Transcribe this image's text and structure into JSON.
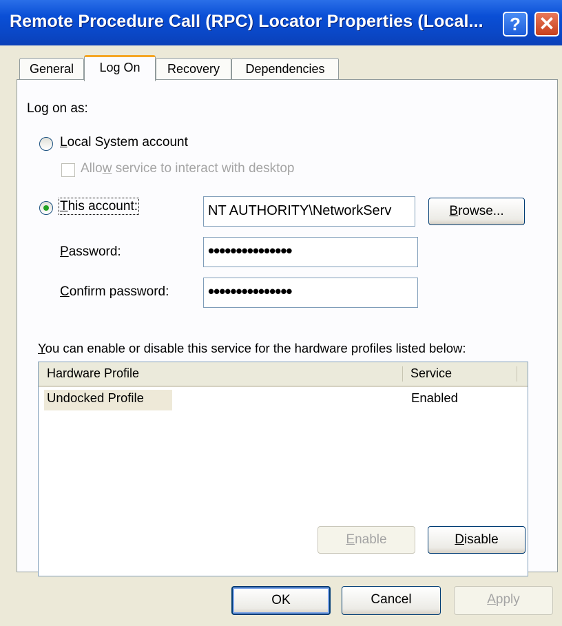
{
  "window": {
    "title": "Remote Procedure Call (RPC) Locator Properties (Local...",
    "help_glyph": "?",
    "close_glyph": "✕"
  },
  "tabs": [
    {
      "label": "General"
    },
    {
      "label": "Log On",
      "active": true
    },
    {
      "label": "Recovery"
    },
    {
      "label": "Dependencies"
    }
  ],
  "logon": {
    "heading": "Log on as:",
    "local_system": {
      "label_key": "L",
      "label_rest": "ocal System account",
      "selected": false
    },
    "interact": {
      "label_pre": "Allo",
      "label_key": "w",
      "label_rest": " service to interact with desktop",
      "checked": false,
      "disabled": true
    },
    "this_account": {
      "label_key": "T",
      "label_rest": "his account:",
      "selected": true,
      "value": "NT AUTHORITY\\NetworkServ"
    },
    "browse": {
      "label_key": "B",
      "label_rest": "rowse..."
    },
    "password": {
      "label_key": "P",
      "label_rest": "assword:",
      "value": "•••••••••••••••"
    },
    "confirm": {
      "label_key": "C",
      "label_rest": "onfirm password:",
      "value": "•••••••••••••••"
    }
  },
  "profiles": {
    "caption_key": "Y",
    "caption_rest": "ou can enable or disable this service for the hardware profiles listed below:",
    "columns": [
      "Hardware Profile",
      "Service"
    ],
    "rows": [
      {
        "profile": "Undocked Profile",
        "service": "Enabled"
      }
    ],
    "enable": {
      "label_key": "E",
      "label_rest": "nable",
      "disabled": true
    },
    "disable": {
      "label_key": "D",
      "label_rest": "isable"
    }
  },
  "footer": {
    "ok": "OK",
    "cancel": "Cancel",
    "apply_key": "A",
    "apply_rest": "pply"
  },
  "colors": {
    "title_bar": "#0a4fd6",
    "face": "#ece9d8",
    "radio_dot": "#21a121",
    "tab_highlight": "#f5a623"
  }
}
